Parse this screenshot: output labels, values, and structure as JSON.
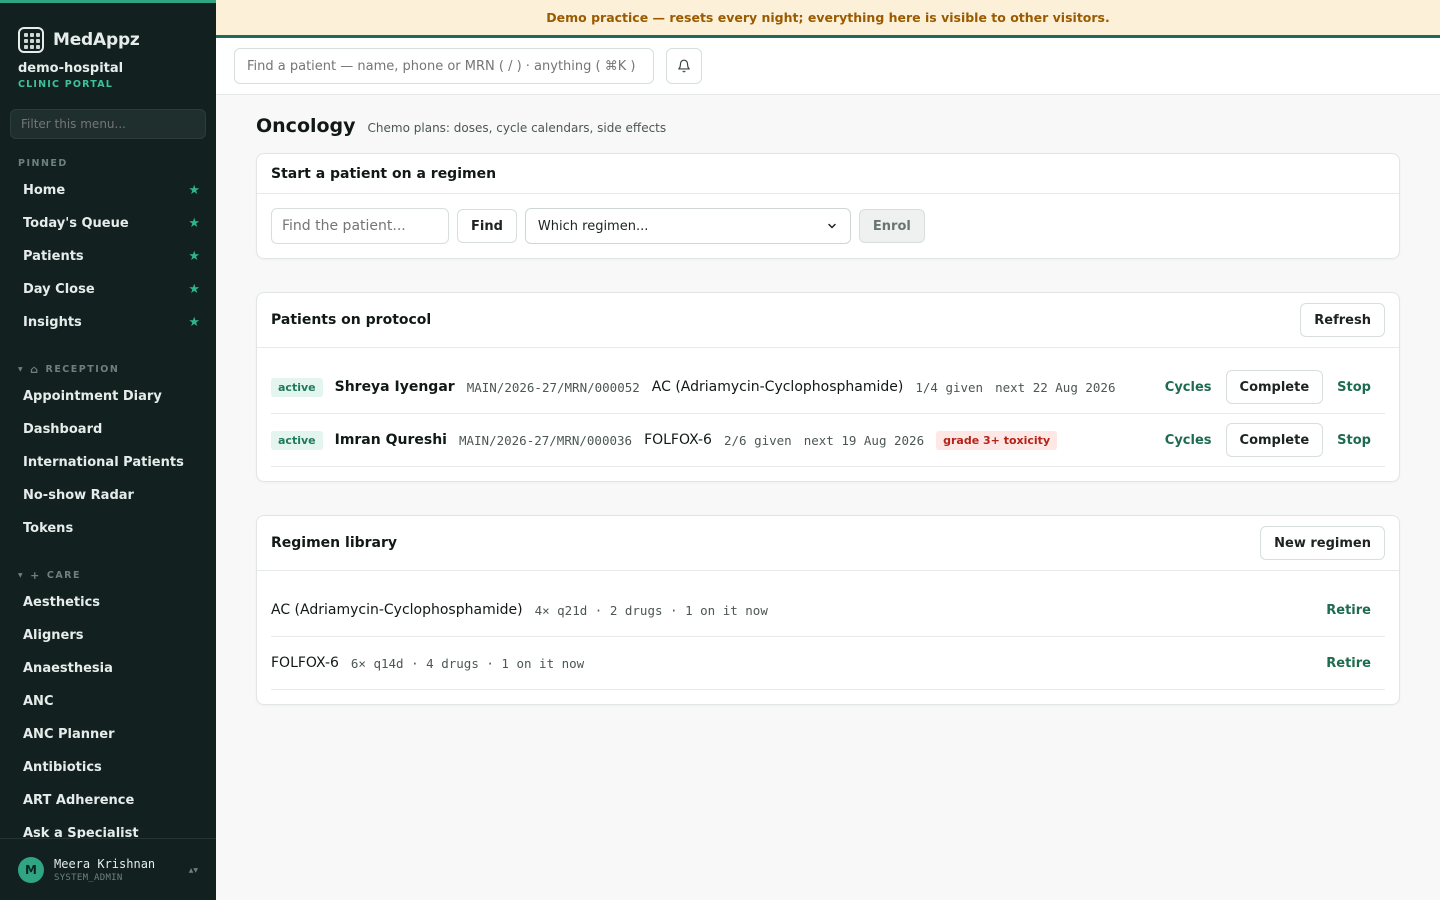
{
  "brand": {
    "name": "MedAppz"
  },
  "org": {
    "name": "demo-hospital",
    "portal": "CLINIC PORTAL"
  },
  "sidebar": {
    "filter_placeholder": "Filter this menu...",
    "pinned_title": "PINNED",
    "pinned": [
      {
        "label": "Home"
      },
      {
        "label": "Today's Queue"
      },
      {
        "label": "Patients"
      },
      {
        "label": "Day Close"
      },
      {
        "label": "Insights"
      }
    ],
    "reception_title": "RECEPTION",
    "reception": [
      {
        "label": "Appointment Diary"
      },
      {
        "label": "Dashboard"
      },
      {
        "label": "International Patients"
      },
      {
        "label": "No-show Radar"
      },
      {
        "label": "Tokens"
      }
    ],
    "care_title": "CARE",
    "care": [
      {
        "label": "Aesthetics"
      },
      {
        "label": "Aligners"
      },
      {
        "label": "Anaesthesia"
      },
      {
        "label": "ANC"
      },
      {
        "label": "ANC Planner"
      },
      {
        "label": "Antibiotics"
      },
      {
        "label": "ART Adherence"
      },
      {
        "label": "Ask a Specialist"
      }
    ],
    "user": {
      "initial": "M",
      "name": "Meera Krishnan",
      "role": "SYSTEM_ADMIN"
    }
  },
  "banner": {
    "text": "Demo practice — resets every night; everything here is visible to other visitors."
  },
  "topbar": {
    "search_placeholder": "Find a patient — name, phone or MRN ( / ) · anything ( ⌘K )"
  },
  "page": {
    "title": "Oncology",
    "subtitle": "Chemo plans: doses, cycle calendars, side effects"
  },
  "enrol": {
    "title": "Start a patient on a regimen",
    "patient_placeholder": "Find the patient...",
    "find_label": "Find",
    "regimen_placeholder": "Which regimen...",
    "enrol_label": "Enrol"
  },
  "protocol": {
    "title": "Patients on protocol",
    "refresh_label": "Refresh",
    "rows": [
      {
        "status": "active",
        "name": "Shreya Iyengar",
        "mrn": "MAIN/2026-27/MRN/000052",
        "regimen": "AC (Adriamycin-Cyclophosphamide)",
        "given": "1/4 given",
        "next": "next 22 Aug 2026",
        "toxicity": "",
        "cycles": "Cycles",
        "complete": "Complete",
        "stop": "Stop"
      },
      {
        "status": "active",
        "name": "Imran Qureshi",
        "mrn": "MAIN/2026-27/MRN/000036",
        "regimen": "FOLFOX-6",
        "given": "2/6 given",
        "next": "next 19 Aug 2026",
        "toxicity": "grade 3+ toxicity",
        "cycles": "Cycles",
        "complete": "Complete",
        "stop": "Stop"
      }
    ]
  },
  "library": {
    "title": "Regimen library",
    "new_label": "New regimen",
    "rows": [
      {
        "name": "AC (Adriamycin-Cyclophosphamide)",
        "meta": "4× q21d · 2 drugs · 1 on it now",
        "retire": "Retire"
      },
      {
        "name": "FOLFOX-6",
        "meta": "6× q14d · 4 drugs · 1 on it now",
        "retire": "Retire"
      }
    ]
  }
}
